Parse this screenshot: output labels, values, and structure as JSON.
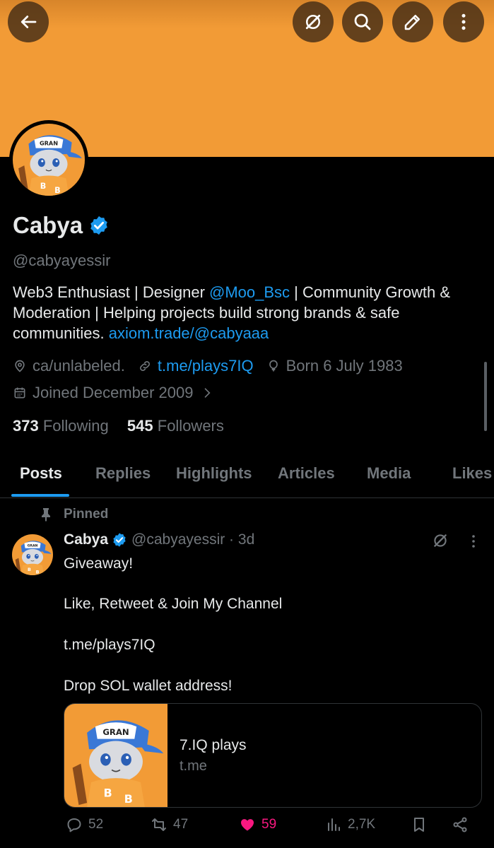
{
  "header": {
    "back_icon": "arrow-left-icon",
    "actions": [
      "grok-icon",
      "search-icon",
      "edit-icon",
      "more-vertical-icon"
    ],
    "banner_color": "#f29b36"
  },
  "profile": {
    "name": "Cabya",
    "handle": "@cabyayessir",
    "bio_part1": "Web3 Enthusiast | Designer ",
    "bio_mention": "@Moo_Bsc",
    "bio_part2": " | Community Growth & Moderation | Helping projects build strong brands & safe communities. ",
    "bio_link": "axiom.trade/@cabyaaa",
    "location": "ca/unlabeled.",
    "website": "t.me/plays7IQ",
    "birthday": "Born 6 July 1983",
    "joined": "Joined December 2009",
    "following_count": "373",
    "following_label": "Following",
    "followers_count": "545",
    "followers_label": "Followers"
  },
  "tabs": [
    "Posts",
    "Replies",
    "Highlights",
    "Articles",
    "Media",
    "Likes"
  ],
  "active_tab": "Posts",
  "post": {
    "pinned_label": "Pinned",
    "author": "Cabya",
    "handle_time": "@cabyayessir · 3d",
    "lines": [
      "Giveaway!",
      "Like, Retweet & Join My Channel",
      "t.me/plays7IQ",
      "Drop SOL wallet address!"
    ],
    "card_title": "7.IQ plays",
    "card_domain": "t.me",
    "replies": "52",
    "reposts": "47",
    "likes": "59",
    "views": "2,7K"
  },
  "colors": {
    "accent": "#1d9bf0",
    "like": "#f91880",
    "muted": "#71767b",
    "text": "#e7e9ea",
    "background": "#000000"
  }
}
